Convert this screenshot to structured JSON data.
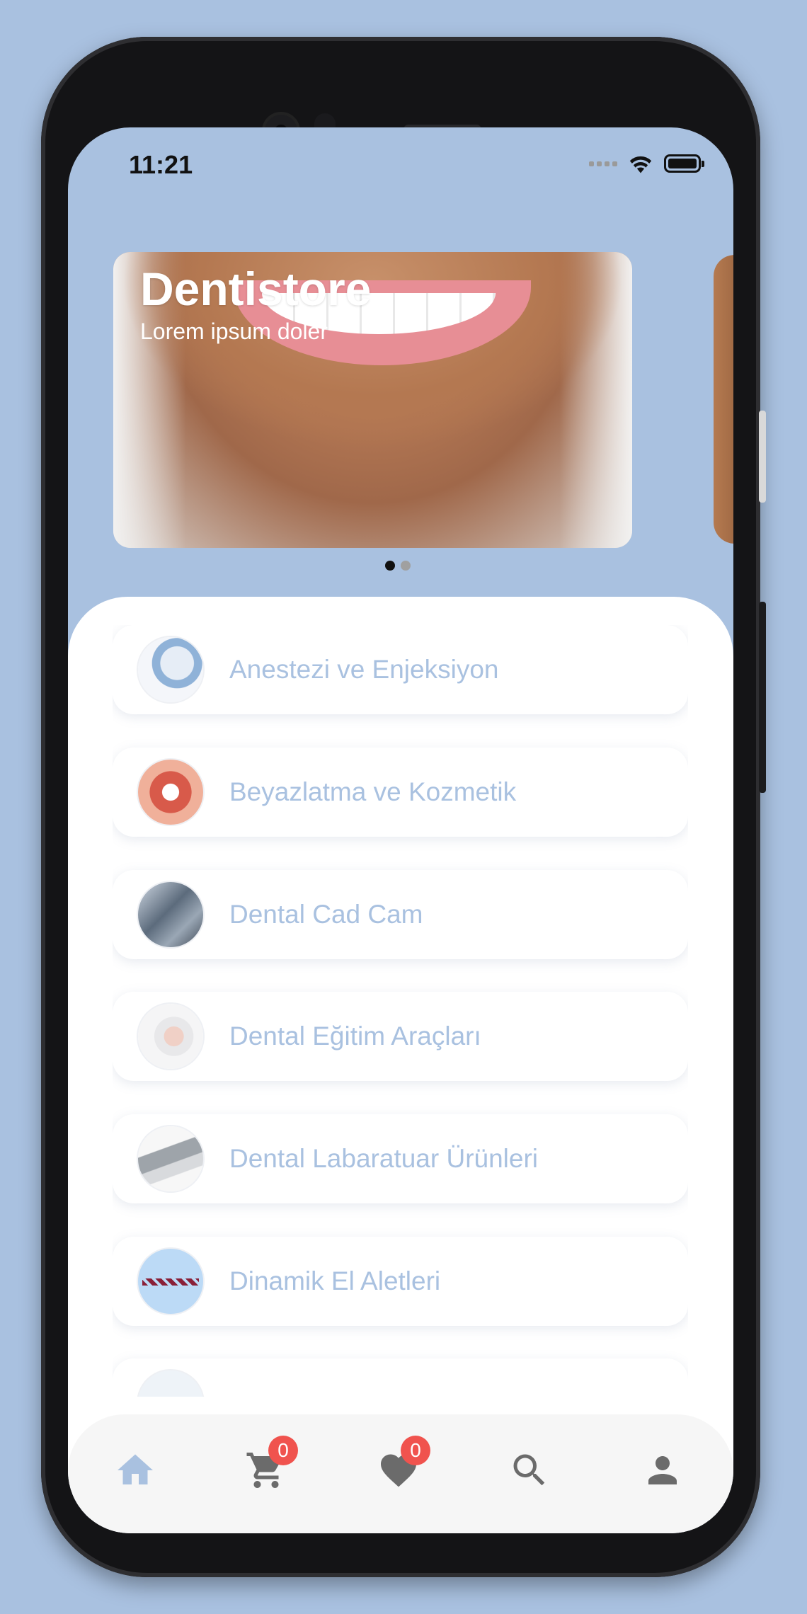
{
  "status_bar": {
    "time": "11:21"
  },
  "banner": {
    "title": "Dentistore",
    "subtitle": "Lorem ipsum doler",
    "page_count": 2,
    "active_page": 1
  },
  "categories": [
    {
      "label": "Anestezi ve Enjeksiyon",
      "icon": "injection-thumbnail"
    },
    {
      "label": "Beyazlatma ve Kozmetik",
      "icon": "smile-thumbnail"
    },
    {
      "label": "Dental Cad Cam",
      "icon": "cad-cam-machine-thumbnail"
    },
    {
      "label": "Dental Eğitim Araçları",
      "icon": "dental-model-thumbnail"
    },
    {
      "label": "Dental Labaratuar Ürünleri",
      "icon": "lab-device-thumbnail"
    },
    {
      "label": "Dinamik El Aletleri",
      "icon": "handpiece-thumbnail"
    },
    {
      "label": "",
      "icon": "partial-thumbnail"
    }
  ],
  "nav": {
    "home": {
      "icon": "home-icon"
    },
    "cart": {
      "icon": "cart-icon",
      "count": "0"
    },
    "favorites": {
      "icon": "heart-icon",
      "count": "0"
    },
    "search": {
      "icon": "search-icon"
    },
    "profile": {
      "icon": "person-icon"
    }
  },
  "colors": {
    "background": "#a9c1e0",
    "accent": "#a9c1e0",
    "badge": "#f0534e",
    "nav_active": "#a9c1e0",
    "nav_inactive": "#6b6b6b"
  }
}
